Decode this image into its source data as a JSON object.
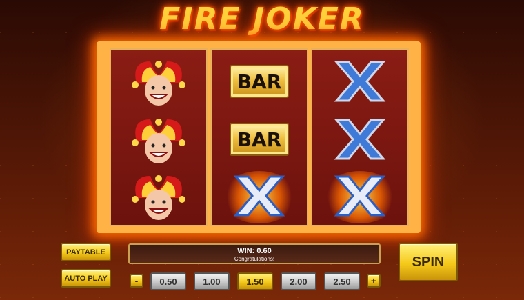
{
  "game": {
    "title": "FIRE JOKER"
  },
  "reels": [
    {
      "symbols": [
        "joker",
        "joker",
        "joker"
      ]
    },
    {
      "symbols": [
        "BAR",
        "BAR",
        "X"
      ]
    },
    {
      "symbols": [
        "X",
        "X",
        "X"
      ]
    }
  ],
  "reel_labels": {
    "bar": "BAR"
  },
  "win": {
    "label": "WIN:",
    "amount": "0.60",
    "message": "Congratulations!"
  },
  "buttons": {
    "paytable": "PAYTABLE",
    "autoplay": "AUTO PLAY",
    "spin": "SPIN",
    "minus": "-",
    "plus": "+"
  },
  "stakes": {
    "options": [
      "0.50",
      "1.00",
      "1.50",
      "2.00",
      "2.50"
    ],
    "selected": "1.50"
  },
  "colors": {
    "gold": "#f5c91a",
    "reel": "#7a1810",
    "fire": "#ff6a00",
    "x_blue": "#2a5fc8"
  },
  "icons": {
    "joker": "joker-icon",
    "x": "x-symbol-icon",
    "flame": "flame-icon"
  }
}
